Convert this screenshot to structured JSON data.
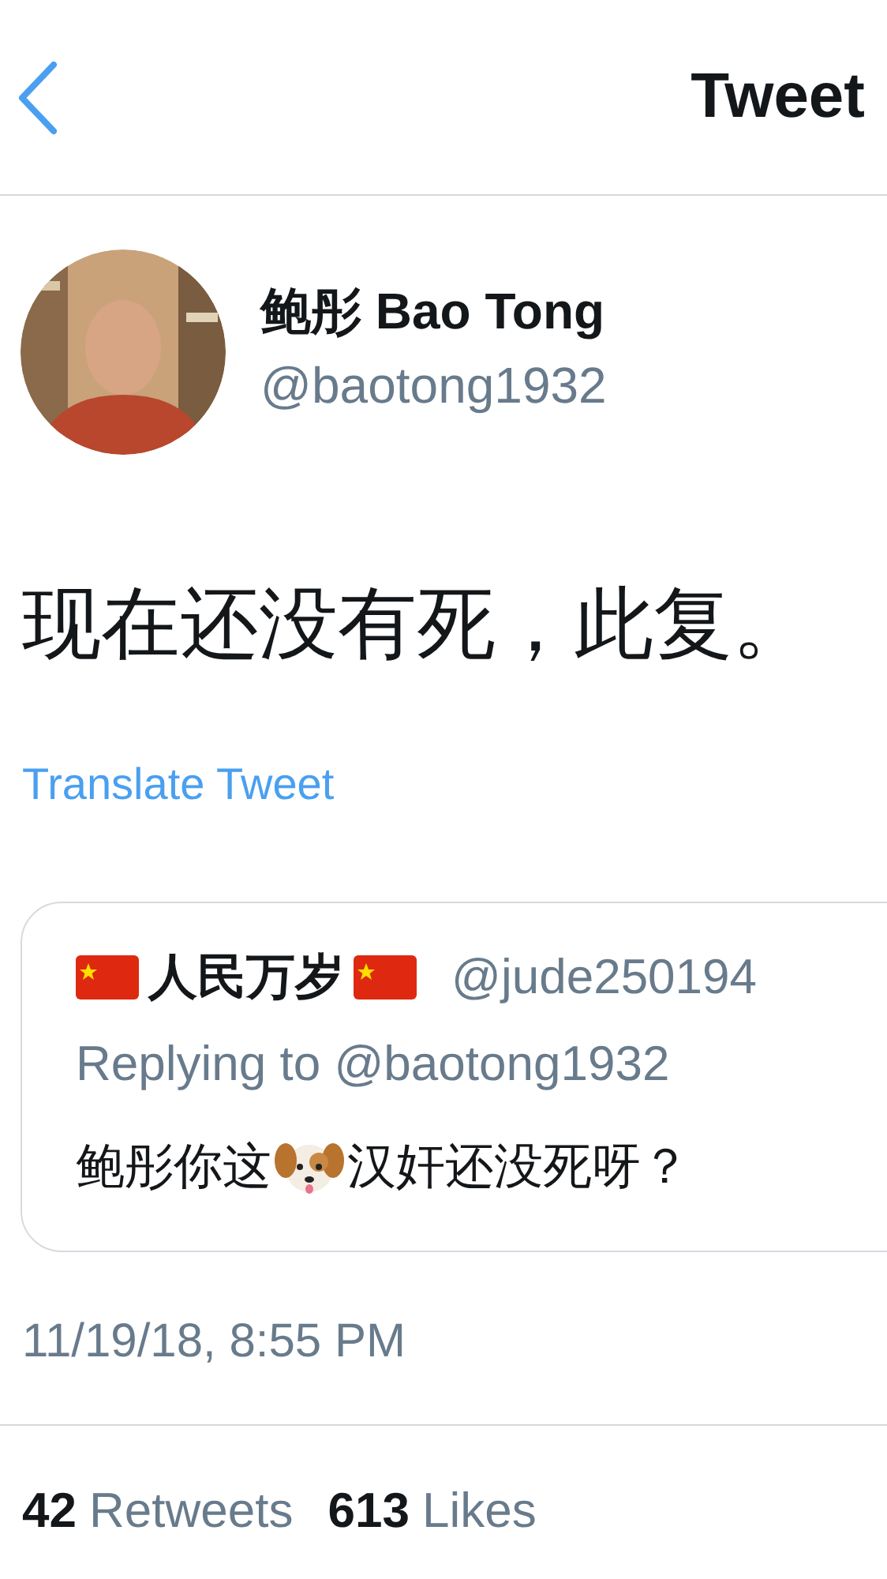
{
  "header": {
    "title": "Tweet"
  },
  "author": {
    "name": "鲍彤 Bao Tong",
    "handle": "@baotong1932"
  },
  "tweet": {
    "text": "现在还没有死，此复。",
    "translate_link": "Translate Tweet"
  },
  "quoted_tweet": {
    "name": "人民万岁",
    "handle": "@jude250194",
    "replying_to": "Replying to @baotong1932",
    "text_before": "鲍彤你这",
    "text_after": "汉奸还没死呀？"
  },
  "timestamp": "11/19/18, 8:55 PM",
  "stats": [
    {
      "count": "42",
      "label": "Retweets"
    },
    {
      "count": "613",
      "label": "Likes"
    }
  ]
}
